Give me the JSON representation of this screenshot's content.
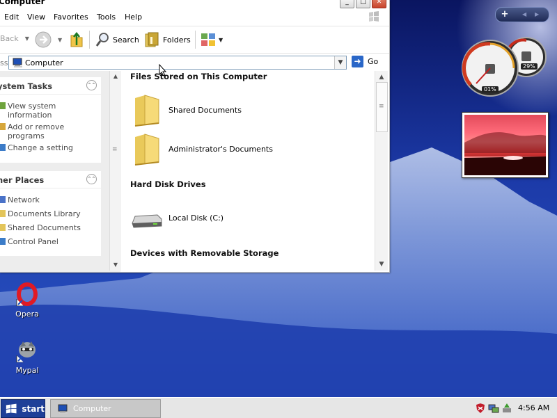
{
  "window": {
    "title": "Computer",
    "menu": [
      "Edit",
      "View",
      "Favorites",
      "Tools",
      "Help"
    ],
    "toolbar": {
      "back": "Back",
      "search": "Search",
      "folders": "Folders"
    },
    "address": {
      "label": "ss",
      "value": "Computer",
      "go": "Go"
    }
  },
  "taskpane": {
    "system_tasks": {
      "title": "ystem Tasks",
      "items": [
        "View system information",
        "Add or remove programs",
        "Change a setting"
      ]
    },
    "other_places": {
      "title": "her Places",
      "items": [
        "Network",
        "Documents Library",
        "Shared Documents",
        "Control Panel"
      ]
    }
  },
  "content": {
    "groups": [
      {
        "title": "Files Stored on This Computer",
        "items": [
          "Shared Documents",
          "Administrator's Documents"
        ]
      },
      {
        "title": "Hard Disk Drives",
        "items": [
          "Local Disk (C:)"
        ]
      },
      {
        "title": "Devices with Removable Storage",
        "items": []
      }
    ]
  },
  "desktop": {
    "icons": [
      "Opera",
      "Mypal"
    ]
  },
  "gadgets": {
    "cpu_percent": "01%",
    "memory_percent": "29%"
  },
  "taskbar": {
    "start": "start",
    "active_task": "Computer",
    "clock": "4:56 AM"
  },
  "colors": {
    "desktop": "#1d3fa6",
    "start_button": "#1f3f98",
    "go_arrow": "#2a67c8"
  }
}
